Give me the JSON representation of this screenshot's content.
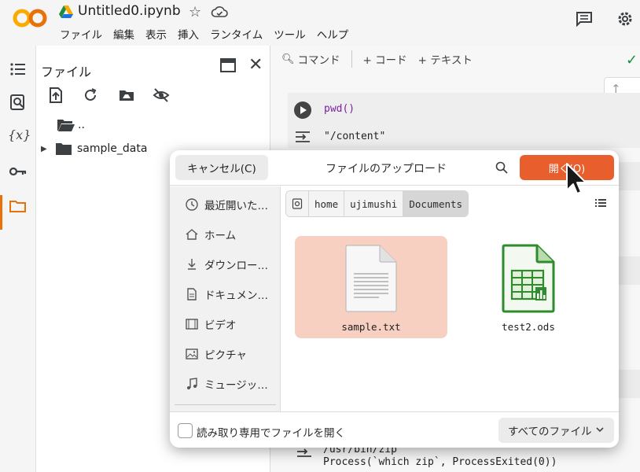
{
  "colab": {
    "notebook_title": "Untitled0.ipynb",
    "menu": [
      "ファイル",
      "編集",
      "表示",
      "挿入",
      "ランタイム",
      "ツール",
      "ヘルプ"
    ],
    "files_panel": {
      "title": "ファイル",
      "tree": [
        {
          "name": ".."
        },
        {
          "name": "sample_data"
        }
      ]
    },
    "command_bar": {
      "command_label": "コマンド",
      "code_label": "+ コード",
      "text_label": "+ テキスト"
    },
    "cell1": {
      "code": "pwd()",
      "output": "\"/content\""
    },
    "cell2": {
      "output_line1": "/usr/bin/zip",
      "output_line2": "Process(`which zip`, ProcessExited(0))"
    }
  },
  "dialog": {
    "cancel_label": "キャンセル(C)",
    "title": "ファイルのアップロード",
    "open_label": "開く(O)",
    "sidebar": [
      {
        "label": "最近開いた…",
        "icon": "recent-icon"
      },
      {
        "label": "ホーム",
        "icon": "home-icon"
      },
      {
        "label": "ダウンロー…",
        "icon": "download-icon"
      },
      {
        "label": "ドキュメン…",
        "icon": "document-icon"
      },
      {
        "label": "ビデオ",
        "icon": "video-icon"
      },
      {
        "label": "ピクチャ",
        "icon": "picture-icon"
      },
      {
        "label": "ミュージッ…",
        "icon": "music-icon"
      }
    ],
    "path": [
      "home",
      "ujimushi",
      "Documents"
    ],
    "files": [
      {
        "name": "sample.txt",
        "selected": true
      },
      {
        "name": "test2.ods",
        "selected": false
      }
    ],
    "readonly_label": "読み取り専用でファイルを開く",
    "readonly_checked": false,
    "filter_label": "すべてのファイル"
  },
  "colors": {
    "accent": "#e95e2d",
    "selection": "#f8d0c2",
    "colab_orange": "#e8710a"
  }
}
